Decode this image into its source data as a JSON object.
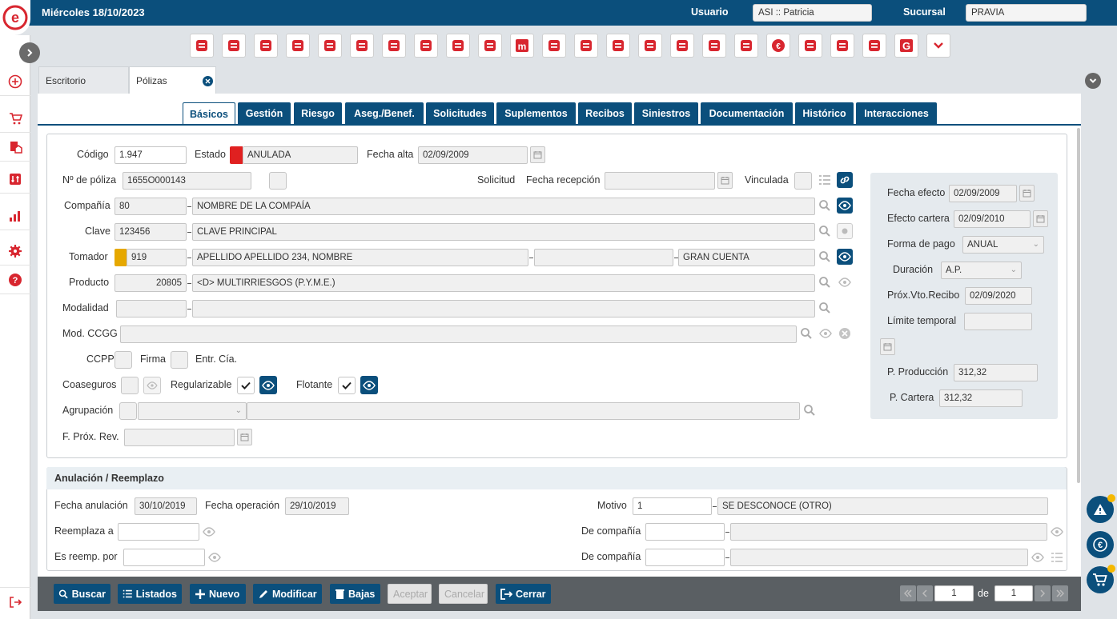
{
  "header": {
    "date": "Miércoles 18/10/2023",
    "user_label": "Usuario",
    "user_value": "ASI :: Patricia",
    "branch_label": "Sucursal",
    "branch_value": "PRAVIA"
  },
  "leftbar": {
    "icons": [
      "add-circle-icon",
      "cart-icon",
      "house-document-icon",
      "sliders-icon",
      "bar-chart-icon",
      "gear-icon",
      "help-icon"
    ],
    "logout_icon": "logout-icon"
  },
  "toolbar_icons": [
    "cube-icon",
    "user-question-icon",
    "user-check-icon",
    "document-icon",
    "list-document-icon",
    "flame-icon",
    "target-icon",
    "money-icon",
    "briefcase-icon",
    "shopping-bag-icon",
    "m-logo-icon",
    "house-doc-icon",
    "building-icon",
    "person-icon",
    "group-icon",
    "buildings-icon",
    "euro-cycle-icon",
    "user-house-icon",
    "euro-icon",
    "house-euro-icon",
    "shield-icon",
    "eye-logo-icon",
    "g-logo-icon",
    "chevron-down-icon"
  ],
  "tabs": [
    {
      "label": "Escritorio"
    },
    {
      "label": "Pólizas"
    }
  ],
  "subtabs": [
    "Básicos",
    "Gestión",
    "Riesgo",
    "Aseg./Benef.",
    "Solicitudes",
    "Suplementos",
    "Recibos",
    "Siniestros",
    "Documentación",
    "Histórico",
    "Interacciones"
  ],
  "form": {
    "codigo_label": "Código",
    "codigo": "1.947",
    "estado_label": "Estado",
    "estado": "ANULADA",
    "estado_color": "#e02020",
    "fecha_alta_label": "Fecha alta",
    "fecha_alta": "02/09/2009",
    "npoliza_label": "Nº de póliza",
    "npoliza": "1655O000143",
    "solicitud_label": "Solicitud",
    "fecha_recepcion_label": "Fecha recepción",
    "vinculada_label": "Vinculada",
    "compania_label": "Compañía",
    "compania_code": "80",
    "compania_name": "NOMBRE DE LA COMPAÍA",
    "clave_label": "Clave",
    "clave_code": "123456",
    "clave_name": "CLAVE PRINCIPAL",
    "tomador_label": "Tomador",
    "tomador_code": "919",
    "tomador_name": "APELLIDO APELLIDO 234, NOMBRE",
    "tomador_group": "GRAN CUENTA",
    "tomador_color": "#e6a800",
    "producto_label": "Producto",
    "producto_code": "20805",
    "producto_name": "<D> MULTIRRIESGOS (P.Y.M.E.)",
    "modalidad_label": "Modalidad",
    "modccgg_label": "Mod. CCGG",
    "ccpp_label": "CCPP",
    "firma_label": "Firma",
    "entr_label": "Entr. Cía.",
    "coaseguros_label": "Coaseguros",
    "regularizable_label": "Regularizable",
    "flotante_label": "Flotante",
    "agrupacion_label": "Agrupación",
    "fprox_label": "F. Próx. Rev."
  },
  "side": {
    "fecha_efecto_label": "Fecha efecto",
    "fecha_efecto": "02/09/2009",
    "efecto_cartera_label": "Efecto cartera",
    "efecto_cartera": "02/09/2010",
    "forma_pago_label": "Forma de pago",
    "forma_pago": "ANUAL",
    "duracion_label": "Duración",
    "duracion": "A.P.",
    "prox_vto_label": "Próx.Vto.Recibo",
    "prox_vto": "02/09/2020",
    "limite_label": "Límite temporal",
    "p_produccion_label": "P. Producción",
    "p_produccion": "312,32",
    "p_cartera_label": "P. Cartera",
    "p_cartera": "312,32"
  },
  "anulacion": {
    "title": "Anulación / Reemplazo",
    "fecha_anulacion_label": "Fecha anulación",
    "fecha_anulacion": "30/10/2019",
    "fecha_operacion_label": "Fecha operación",
    "fecha_operacion": "29/10/2019",
    "motivo_label": "Motivo",
    "motivo_code": "1",
    "motivo_text": "SE DESCONOCE (OTRO)",
    "reemplaza_label": "Reemplaza a",
    "es_reemp_label": "Es reemp. por",
    "de_compania_label": "De compañía"
  },
  "bottom": {
    "buscar": "Buscar",
    "listados": "Listados",
    "nuevo": "Nuevo",
    "modificar": "Modificar",
    "bajas": "Bajas",
    "aceptar": "Aceptar",
    "cancelar": "Cancelar",
    "cerrar": "Cerrar",
    "page": "1",
    "of_label": "de",
    "total": "1"
  },
  "colors": {
    "primary": "#0b4f7c",
    "accent_red": "#d8262f",
    "badge": "#f5b800"
  }
}
